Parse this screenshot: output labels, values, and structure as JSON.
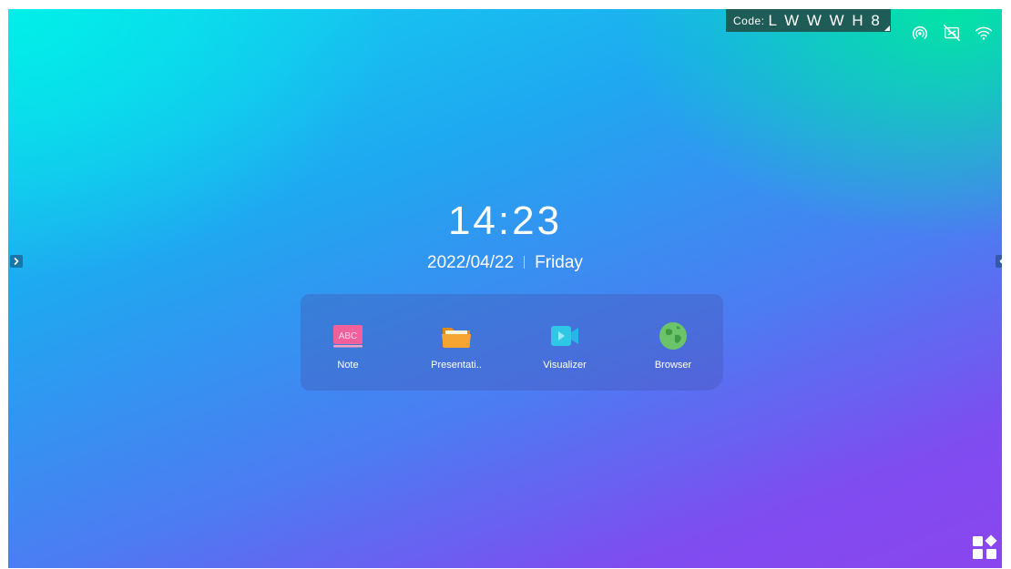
{
  "status_bar": {
    "code_label": "Code:",
    "code_value": "L W W W H 8",
    "icons": [
      "hotspot-icon",
      "screen-share-off-icon",
      "wifi-icon"
    ]
  },
  "clock": {
    "time": "14:23",
    "date": "2022/04/22",
    "weekday": "Friday"
  },
  "dock": {
    "apps": [
      {
        "label": "Note",
        "icon": "note-icon"
      },
      {
        "label": "Presentati..",
        "icon": "folder-icon"
      },
      {
        "label": "Visualizer",
        "icon": "video-camera-icon"
      },
      {
        "label": "Browser",
        "icon": "globe-icon"
      }
    ]
  },
  "note_icon_text": "ABC",
  "colors": {
    "code_badge_bg": "#1f5c57",
    "note_icon": "#f0609a",
    "folder_icon": "#f7a532",
    "visualizer_icon": "#2ec7e6",
    "browser_icon": "#6cc46a"
  }
}
